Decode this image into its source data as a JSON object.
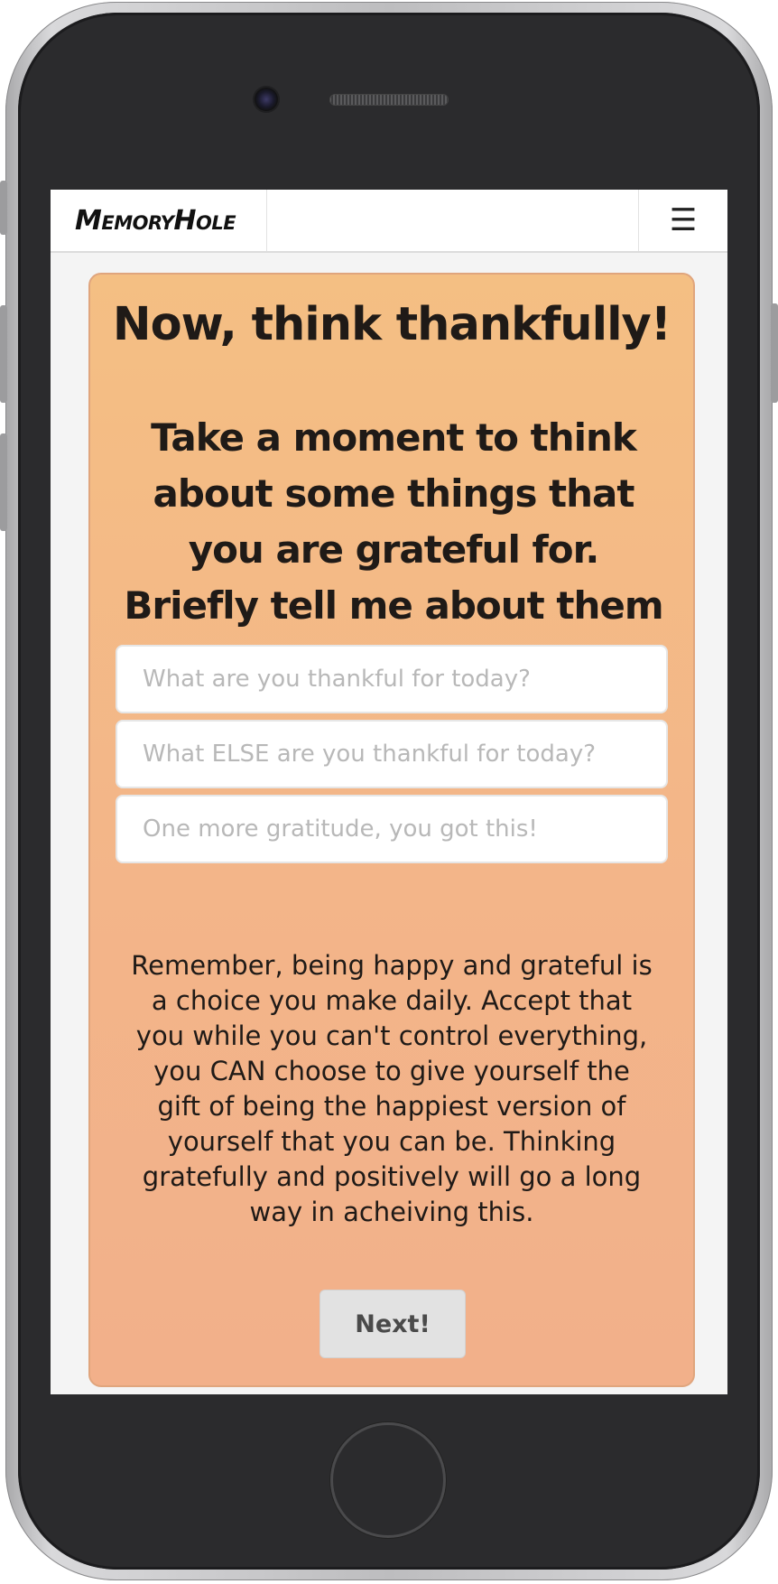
{
  "app": {
    "brand": "MemoryHole",
    "menu_icon": "hamburger-icon"
  },
  "card": {
    "heading": "Now, think thankfully!",
    "subheading": "Take a moment to think about some things that you are grateful for. Briefly tell me about them below.",
    "fields": [
      {
        "placeholder": "What are you thankful for today?",
        "value": ""
      },
      {
        "placeholder": "What ELSE are you thankful for today?",
        "value": ""
      },
      {
        "placeholder": "One more gratitude, you got this!",
        "value": ""
      }
    ],
    "note": "Remember, being happy and grateful is a choice you make daily. Accept that you while you can't control everything, you CAN choose to give yourself the gift of being the happiest version of yourself that you can be. Thinking gratefully and positively will go a long way in acheiving this.",
    "next_label": "Next!"
  },
  "colors": {
    "card_top": "#f4bf83",
    "card_bottom": "#f2b08a",
    "button_bg": "#e2e2e2",
    "phone_body": "#2b2b2d"
  }
}
